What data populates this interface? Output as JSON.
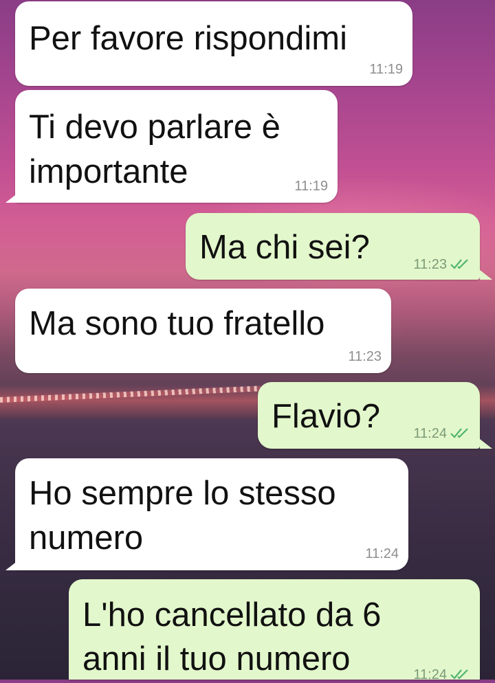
{
  "chat": {
    "messages": [
      {
        "direction": "incoming",
        "text_lines": [
          "Per favore rispondimi"
        ],
        "time": "11:19"
      },
      {
        "direction": "incoming",
        "text_lines": [
          "Ti devo parlare è",
          "importante"
        ],
        "time": "11:19"
      },
      {
        "direction": "outgoing",
        "text_lines": [
          "Ma chi sei?"
        ],
        "time": "11:23",
        "read": true
      },
      {
        "direction": "incoming",
        "text_lines": [
          "Ma sono tuo fratello"
        ],
        "time": "11:23"
      },
      {
        "direction": "outgoing",
        "text_lines": [
          "Flavio?"
        ],
        "time": "11:24",
        "read": true
      },
      {
        "direction": "incoming",
        "text_lines": [
          "Ho sempre lo stesso",
          "numero"
        ],
        "time": "11:24"
      },
      {
        "direction": "outgoing",
        "text_lines": [
          "L'ho cancellato da 6",
          "anni il tuo numero"
        ],
        "time": "11:24",
        "read": true
      }
    ]
  },
  "colors": {
    "incoming_bubble": "#ffffff",
    "outgoing_bubble": "#e2f7cb",
    "read_ticks": "#4fb56c"
  },
  "icons": {
    "read_receipt": "double-check-icon"
  }
}
